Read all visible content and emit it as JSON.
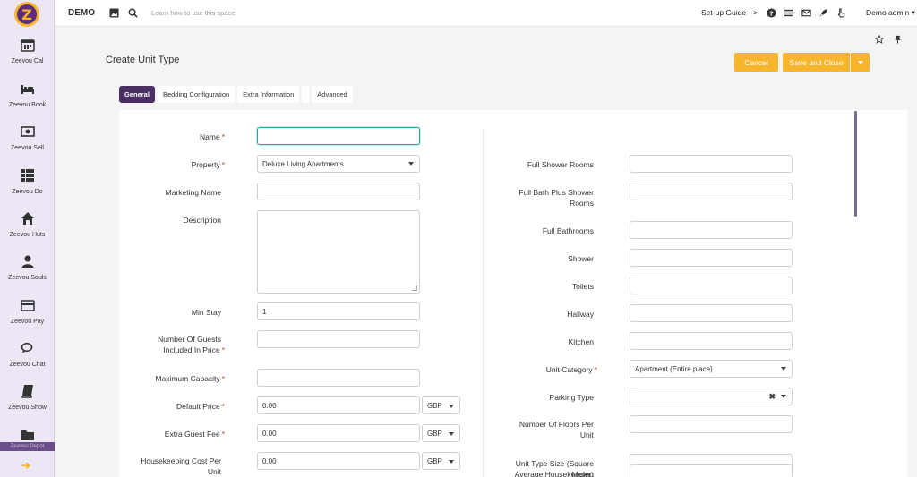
{
  "app": {
    "brand": "DEMO",
    "search_hint": "Learn how to use this space",
    "setup_guide": "Set-up Guide -->",
    "user": "Demo admin"
  },
  "sidebar": {
    "items": [
      {
        "label": "Zeevou Cal",
        "icon": "calendar-icon"
      },
      {
        "label": "Zeevou Book",
        "icon": "bed-icon"
      },
      {
        "label": "Zeevou Sell",
        "icon": "money-icon"
      },
      {
        "label": "Zeevou Do",
        "icon": "grid-icon"
      },
      {
        "label": "Zeevou Huts",
        "icon": "home-icon"
      },
      {
        "label": "Zeevou Souls",
        "icon": "user-icon"
      },
      {
        "label": "Zeevou Pay",
        "icon": "credit-card-icon"
      },
      {
        "label": "Zeevou Chat",
        "icon": "chat-icon"
      },
      {
        "label": "Zeevou Show",
        "icon": "book-icon"
      },
      {
        "label": "Zeevou Depot",
        "icon": "folder-icon"
      }
    ]
  },
  "page": {
    "title": "Create Unit Type",
    "cancel": "Cancel",
    "save_close": "Save and Close"
  },
  "tabs": [
    "General",
    "Bedding Configuration",
    "Extra Information",
    "",
    "Advanced"
  ],
  "left_fields": {
    "name": "Name",
    "property": "Property",
    "property_value": "Deluxe Living Apartments",
    "marketing_name": "Marketing Name",
    "description": "Description",
    "min_stay": "Min Stay",
    "min_stay_value": "1",
    "guests_included_1": "Number Of Guests",
    "guests_included_2": "Included In Price",
    "max_capacity": "Maximum Capacity",
    "default_price": "Default Price",
    "default_price_value": "0.00",
    "extra_guest_fee": "Extra Guest Fee",
    "extra_guest_fee_value": "0.00",
    "housekeeping_1": "Housekeeping Cost Per",
    "housekeeping_2": "Unit",
    "housekeeping_value": "0.00",
    "currency": "GBP"
  },
  "right_fields": {
    "full_shower_rooms": "Full Shower Rooms",
    "full_bath_shower_1": "Full Bath Plus Shower",
    "full_bath_shower_2": "Rooms",
    "full_bathrooms": "Full Bathrooms",
    "shower": "Shower",
    "toilets": "Toilets",
    "hallway": "Hallway",
    "kitchen": "Kitchen",
    "unit_category": "Unit Category",
    "unit_category_value": "Apartment (Entire place)",
    "parking_type": "Parking Type",
    "floors_1": "Number Of Floors Per",
    "floors_2": "Unit",
    "unit_size_1": "Unit Type Size (Square",
    "unit_size_2": "Meter)",
    "avg_housekeeping": "Average Housekeeping"
  },
  "colors": {
    "accent": "#f6b52a",
    "brand_purple": "#4a2f62",
    "sidebar_bg": "#ede7f5",
    "focus": "#2aa3a0"
  }
}
